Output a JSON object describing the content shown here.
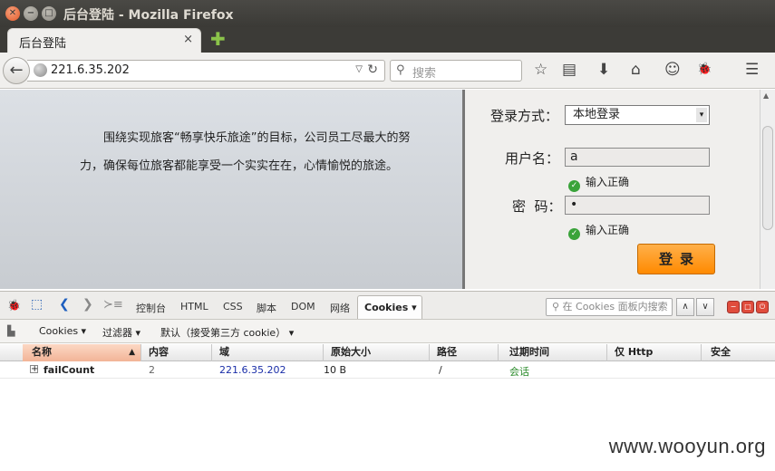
{
  "window": {
    "title": "后台登陆 - Mozilla Firefox",
    "close_glyph": "✕",
    "min_glyph": "−",
    "max_glyph": "□"
  },
  "tabs": [
    {
      "label": "后台登陆",
      "active": true,
      "close_glyph": "×"
    }
  ],
  "newtab_glyph": "✚",
  "navbar": {
    "back_glyph": "←",
    "url": "221.6.35.202",
    "dropdown_glyph": "▽",
    "reload_glyph": "↻",
    "search_placeholder": "搜索",
    "search_glyph": "⚲",
    "icons": [
      {
        "name": "bookmark-star-icon",
        "glyph": "☆"
      },
      {
        "name": "reading-list-icon",
        "glyph": "▤"
      },
      {
        "name": "download-icon",
        "glyph": "⬇"
      },
      {
        "name": "home-icon",
        "glyph": "⌂"
      },
      {
        "name": "hello-icon",
        "glyph": "☺"
      },
      {
        "name": "firebug-icon",
        "glyph": "🐞"
      },
      {
        "name": "menu-icon",
        "glyph": "☰"
      }
    ]
  },
  "page": {
    "intro": "围绕实现旅客“畅享快乐旅途”的目标，公司员工尽最大的努力，确保每位旅客都能享受一个实实在在，心情愉悦的旅途。",
    "login_method_label": "登录方式：",
    "login_method_value": "本地登录",
    "select_arrow": "▾",
    "username_label": "用户名：",
    "username_value": "a",
    "username_status": "输入正确",
    "password_label": "密  码：",
    "password_value": "•",
    "password_status": "输入正确",
    "ok_glyph": "✓",
    "login_button": "登录"
  },
  "devtools": {
    "tabs": [
      "控制台",
      "HTML",
      "CSS",
      "脚本",
      "DOM",
      "网络"
    ],
    "active_tab": "Cookies ▾",
    "search_placeholder": "⚲ 在 Cookies 面板内搜索",
    "up_glyph": "∧",
    "down_glyph": "∨",
    "cookie_toolbar": {
      "cookies_menu": "Cookies ▾",
      "filter_menu": "过滤器 ▾",
      "default_menu": "默认（接受第三方 cookie） ▾"
    },
    "columns": [
      "名称",
      "内容",
      "域",
      "原始大小",
      "路径",
      "过期时间",
      "仅 Http",
      "安全"
    ],
    "sort_glyph": "▲",
    "rows": [
      {
        "name": "failCount",
        "content": "2",
        "domain": "221.6.35.202",
        "raw_size": "10 B",
        "path": "/",
        "expires": "会话",
        "http_only": "",
        "secure": ""
      }
    ]
  },
  "watermark": "www.wooyun.org",
  "colors": {
    "domain_link": "#1a2ea8",
    "session_green": "#2a8a2a",
    "login_orange": "#ff8a00"
  }
}
